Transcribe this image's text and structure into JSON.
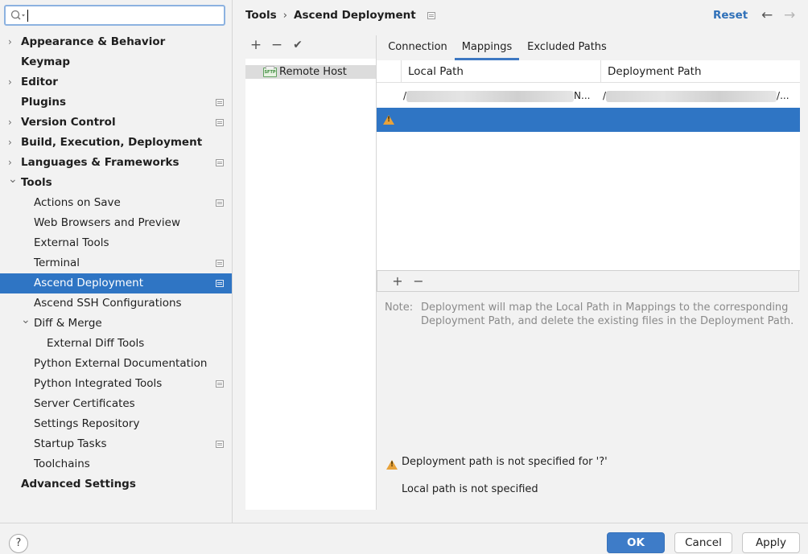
{
  "search": {
    "value": "",
    "placeholder": ""
  },
  "sidebar": {
    "items": [
      {
        "label": "Appearance & Behavior",
        "bold": true,
        "arrow": "collapsed",
        "project": false
      },
      {
        "label": "Keymap",
        "bold": true,
        "arrow": "none",
        "project": false
      },
      {
        "label": "Editor",
        "bold": true,
        "arrow": "collapsed",
        "project": false
      },
      {
        "label": "Plugins",
        "bold": true,
        "arrow": "none",
        "project": true
      },
      {
        "label": "Version Control",
        "bold": true,
        "arrow": "collapsed",
        "project": true
      },
      {
        "label": "Build, Execution, Deployment",
        "bold": true,
        "arrow": "collapsed",
        "project": false
      },
      {
        "label": "Languages & Frameworks",
        "bold": true,
        "arrow": "collapsed",
        "project": true
      },
      {
        "label": "Tools",
        "bold": true,
        "arrow": "expanded",
        "project": false
      },
      {
        "label": "Actions on Save",
        "bold": false,
        "arrow": "none",
        "project": true
      },
      {
        "label": "Web Browsers and Preview",
        "bold": false,
        "arrow": "none",
        "project": false
      },
      {
        "label": "External Tools",
        "bold": false,
        "arrow": "none",
        "project": false
      },
      {
        "label": "Terminal",
        "bold": false,
        "arrow": "none",
        "project": true
      },
      {
        "label": "Ascend Deployment",
        "bold": false,
        "arrow": "none",
        "project": true,
        "selected": true
      },
      {
        "label": "Ascend SSH Configurations",
        "bold": false,
        "arrow": "none",
        "project": false
      },
      {
        "label": "Diff & Merge",
        "bold": false,
        "arrow": "expanded",
        "project": false
      },
      {
        "label": "External Diff Tools",
        "bold": false,
        "arrow": "none",
        "project": false
      },
      {
        "label": "Python External Documentation",
        "bold": false,
        "arrow": "none",
        "project": false
      },
      {
        "label": "Python Integrated Tools",
        "bold": false,
        "arrow": "none",
        "project": true
      },
      {
        "label": "Server Certificates",
        "bold": false,
        "arrow": "none",
        "project": false
      },
      {
        "label": "Settings Repository",
        "bold": false,
        "arrow": "none",
        "project": false
      },
      {
        "label": "Startup Tasks",
        "bold": false,
        "arrow": "none",
        "project": true
      },
      {
        "label": "Toolchains",
        "bold": false,
        "arrow": "none",
        "project": false
      },
      {
        "label": "Advanced Settings",
        "bold": true,
        "arrow": "none",
        "project": false
      }
    ]
  },
  "header": {
    "crumb1": "Tools",
    "separator": "›",
    "crumb2": "Ascend Deployment",
    "reset": "Reset",
    "back": "←",
    "forward": "→"
  },
  "hosts": {
    "add": "+",
    "remove": "−",
    "check": "✔",
    "items": [
      {
        "name": "Remote Host",
        "icon_text": "SFTP"
      }
    ]
  },
  "tabs": [
    "Connection",
    "Mappings",
    "Excluded Paths"
  ],
  "active_tab": "Mappings",
  "mappings": {
    "columns": [
      "Local Path",
      "Deployment Path"
    ],
    "rows": [
      {
        "local_start": "/",
        "local_end": "N...",
        "deploy_start": "/",
        "deploy_end": "/..."
      }
    ],
    "add": "+",
    "remove": "−"
  },
  "note": {
    "label": "Note:",
    "text": "Deployment will map the Local Path in Mappings to the corresponding Deployment Path, and delete the existing files in the Deployment Path."
  },
  "messages": {
    "warning": "Deployment path is not specified for '?'",
    "info": "Local path is not specified"
  },
  "footer": {
    "help": "?",
    "ok": "OK",
    "cancel": "Cancel",
    "apply": "Apply"
  },
  "colors": {
    "accent": "#2f75c4",
    "warning": "#e8a23a",
    "link": "#2f70b8"
  }
}
